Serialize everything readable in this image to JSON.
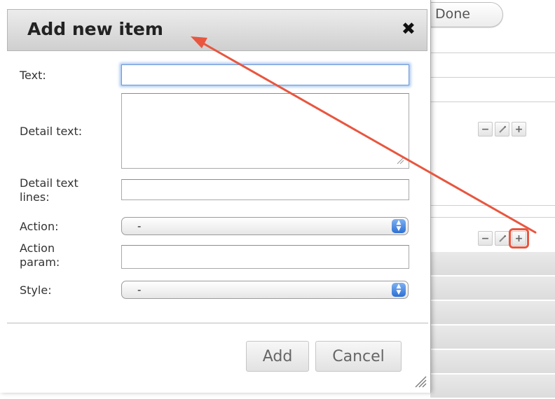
{
  "background": {
    "done_label": "Done",
    "panel_buttons": {
      "minus": "−",
      "plus": "+"
    }
  },
  "dialog": {
    "title": "Add new item",
    "close_icon": "✖",
    "fields": {
      "text_label": "Text:",
      "text_value": "",
      "detail_text_label": "Detail text:",
      "detail_text_value": "",
      "detail_lines_label": "Detail text lines:",
      "detail_lines_value": "",
      "action_label": "Action:",
      "action_value": "-",
      "action_param_label": "Action param:",
      "action_param_value": "",
      "style_label": "Style:",
      "style_value": "-"
    },
    "buttons": {
      "add": "Add",
      "cancel": "Cancel"
    }
  },
  "colors": {
    "annotation": "#e8563f",
    "focus_ring": "#9ec0ee",
    "select_arrow": "#2e6fd4"
  }
}
